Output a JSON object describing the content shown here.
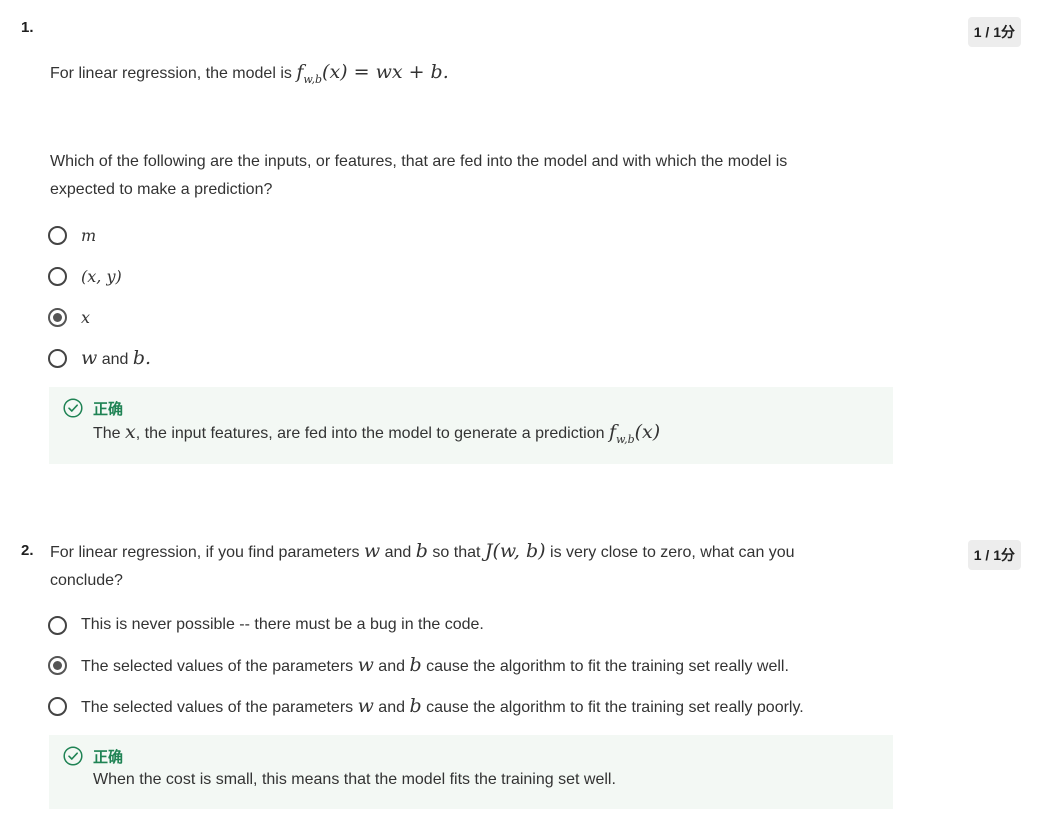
{
  "q1": {
    "number": "1.",
    "score": "1 / 1分",
    "stem_prefix": "For linear regression, the model is ",
    "stem_formula": "f",
    "stem_formula_sub": "w,b",
    "stem_formula_rest": "(x) = wx + b.",
    "question": "Which of the following are the inputs, or features, that are fed into the model and with which the model is expected to make a prediction?",
    "options": [
      {
        "label": "m"
      },
      {
        "label": "(x, y)"
      },
      {
        "label": "x"
      },
      {
        "label_math_1": "w",
        "label_text": " and ",
        "label_math_2": "b."
      }
    ],
    "selected_index": 2,
    "feedback": {
      "title": "正确",
      "text_prefix": "The ",
      "text_math": "x",
      "text_mid": ", the input features, are fed into the model to generate a prediction ",
      "text_formula": "f",
      "text_formula_sub": "w,b",
      "text_formula_rest": "(x)"
    }
  },
  "q2": {
    "number": "2.",
    "score": "1 / 1分",
    "stem_1": "For linear regression, if you find parameters ",
    "stem_m1": "w",
    "stem_2": " and ",
    "stem_m2": "b",
    "stem_3": " so that ",
    "stem_m3": "J(w, b)",
    "stem_4": " is very close to zero, what can you",
    "stem_5": "conclude?",
    "options": [
      {
        "text": "This is never possible -- there must be a bug in the code."
      },
      {
        "t1": "The selected values of the parameters ",
        "m1": "w",
        "t2": " and ",
        "m2": "b",
        "t3": " cause the algorithm to fit the training set really well."
      },
      {
        "t1": "The selected values of the parameters ",
        "m1": "w",
        "t2": " and ",
        "m2": "b",
        "t3": " cause the algorithm to fit the training set really poorly."
      }
    ],
    "selected_index": 1,
    "feedback": {
      "title": "正确",
      "text": "When the cost is small, this means that the model fits the training set well."
    }
  },
  "colors": {
    "correct_green": "#1f8354",
    "feedback_bg": "#f3f8f4",
    "score_bg": "#ededed"
  },
  "icons": {
    "feedback": "check-circle-icon"
  }
}
